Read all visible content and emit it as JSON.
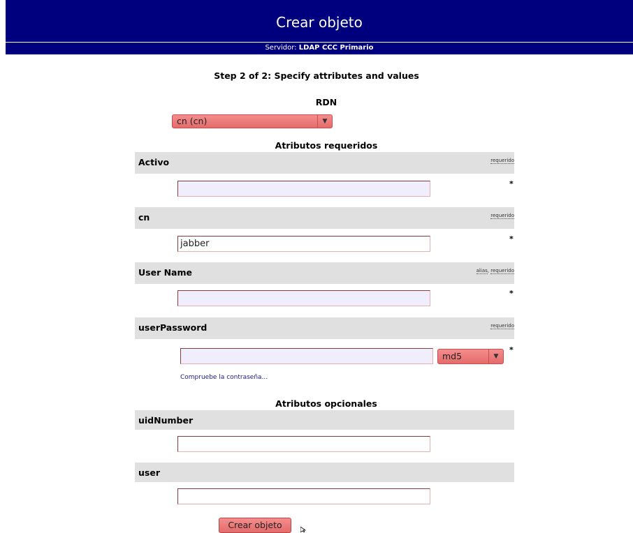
{
  "header": {
    "title": "Crear objeto",
    "server_prefix": "Servidor:",
    "server_name": "LDAP CCC Primario"
  },
  "step_title": "Step 2 of 2: Specify attributes and values",
  "rdn": {
    "label": "RDN",
    "selected": "cn (cn)"
  },
  "required_section_title": "Atributos requeridos",
  "optional_section_title": "Atributos opcionales",
  "required_attributes": [
    {
      "name": "Activo",
      "tags": "requerido",
      "value": "",
      "marker": "*"
    },
    {
      "name": "cn",
      "tags": "requerido",
      "value": "jabber",
      "marker": "*"
    },
    {
      "name": "User Name",
      "alias_tag": "alias",
      "tags": "requerido",
      "value": "",
      "marker": "*"
    },
    {
      "name": "userPassword",
      "tags": "requerido",
      "value": "",
      "marker": "*",
      "hash_selected": "md5"
    }
  ],
  "check_password_link": "Compruebe la contraseña...",
  "optional_attributes": [
    {
      "name": "uidNumber",
      "value": ""
    },
    {
      "name": "user",
      "value": ""
    }
  ],
  "submit_label": "Crear objeto",
  "colors": {
    "header_bg": "#00007f",
    "attr_bar_bg": "#e0e0e0",
    "select_bg": "#e97a7a",
    "field_bg": "#f0eefc",
    "link": "#1a1a8c"
  }
}
